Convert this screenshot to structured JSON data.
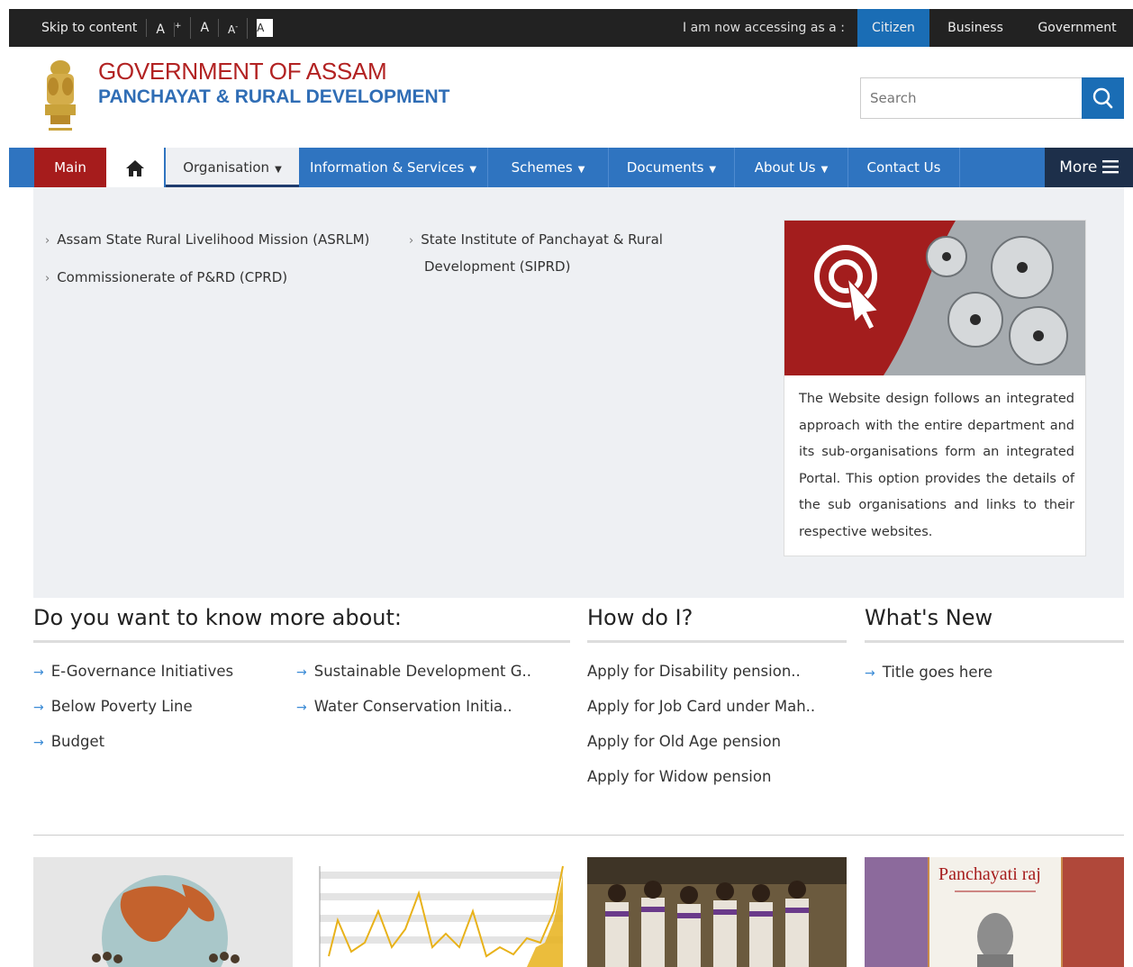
{
  "topbar": {
    "skip": "Skip to content",
    "font_plus": "A",
    "font_plus_sup": "+",
    "font_normal": "A",
    "font_minus": "A-",
    "contrast": "A",
    "access_label": "I am now accessing as a :",
    "roles": [
      "Citizen",
      "Business",
      "Government"
    ]
  },
  "header": {
    "line1": "GOVERNMENT OF ASSAM",
    "line2": "PANCHAYAT & RURAL DEVELOPMENT"
  },
  "search": {
    "placeholder": "Search"
  },
  "nav": {
    "main": "Main",
    "organisation": "Organisation",
    "info": "Information & Services",
    "schemes": "Schemes",
    "documents": "Documents",
    "about": "About Us",
    "contact": "Contact Us",
    "more": "More"
  },
  "organisation_menu": {
    "links": [
      "Assam State Rural Livelihood Mission (ASRLM)",
      "Commissionerate of P&RD (CPRD)",
      "State Institute of Panchayat & Rural",
      "Development (SIPRD)"
    ],
    "promo_text": "The Website design follows an integrated approach with the entire department and its sub-organisations form an integrated Portal. This option provides the details of the sub organisations and links to their respective websites."
  },
  "know_more": {
    "title": "Do you want to know more about:",
    "items": [
      "E-Governance Initiatives",
      "Below Poverty Line",
      "Budget",
      "Sustainable Development G..",
      "Water Conservation Initia.."
    ]
  },
  "how_do_i": {
    "title": "How do I?",
    "items": [
      "Apply for Disability pension..",
      "Apply for Job Card under Mah..",
      "Apply for Old Age pension",
      "Apply for Widow pension"
    ]
  },
  "whats_new": {
    "title": "What's New",
    "items": [
      "Title goes here"
    ]
  },
  "tiles": {
    "panchayati_label": "Panchayati raj"
  },
  "colors": {
    "brand_red": "#a61c1c",
    "nav_blue": "#2f74c0",
    "link_arrow": "#3b8bd6"
  }
}
